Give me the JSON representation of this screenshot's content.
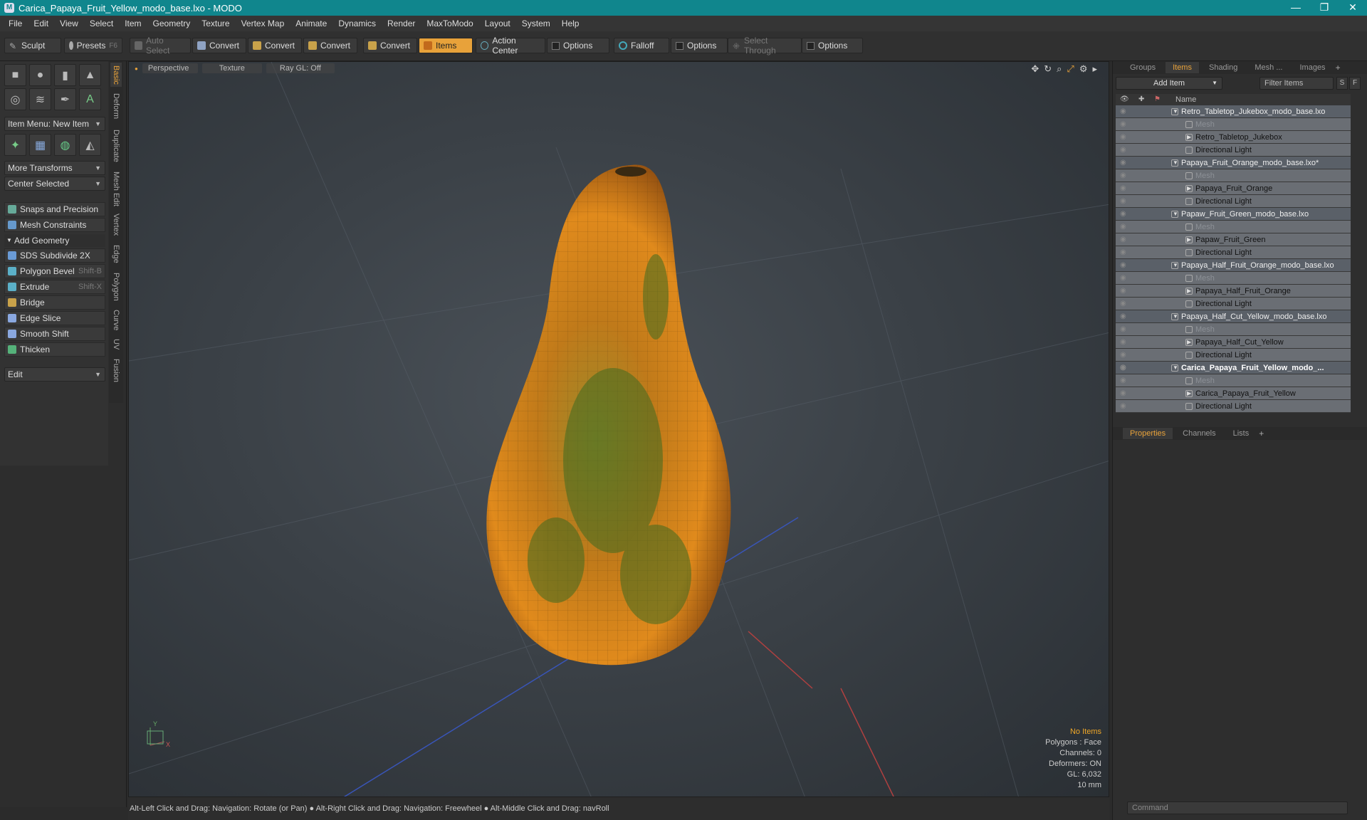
{
  "window": {
    "title": "Carica_Papaya_Fruit_Yellow_modo_base.lxo - MODO"
  },
  "menu": [
    "File",
    "Edit",
    "View",
    "Select",
    "Item",
    "Geometry",
    "Texture",
    "Vertex Map",
    "Animate",
    "Dynamics",
    "Render",
    "MaxToModo",
    "Layout",
    "System",
    "Help"
  ],
  "toolbar": {
    "sculpt": "Sculpt",
    "presets": "Presets",
    "presets_key": "F6",
    "auto_select": "Auto Select",
    "convert": "Convert",
    "items": "Items",
    "action_center": "Action Center",
    "options": "Options",
    "falloff": "Falloff",
    "select_through": "Select Through"
  },
  "left": {
    "item_menu": "Item Menu: New Item",
    "more_transforms": "More Transforms",
    "center_selected": "Center Selected",
    "snaps": "Snaps and Precision",
    "mesh_constraints": "Mesh Constraints",
    "add_geometry": "Add Geometry",
    "tools": [
      {
        "label": "SDS Subdivide 2X",
        "shortcut": "",
        "color": "#6a9bd6"
      },
      {
        "label": "Polygon Bevel",
        "shortcut": "Shift-B",
        "color": "#5bb0c8"
      },
      {
        "label": "Extrude",
        "shortcut": "Shift-X",
        "color": "#5bb0c8"
      },
      {
        "label": "Bridge",
        "shortcut": "",
        "color": "#c9a24a"
      },
      {
        "label": "Edge Slice",
        "shortcut": "",
        "color": "#8aa8e0"
      },
      {
        "label": "Smooth Shift",
        "shortcut": "",
        "color": "#8aa8e0"
      },
      {
        "label": "Thicken",
        "shortcut": "",
        "color": "#55b27a"
      }
    ],
    "edit_dropdown": "Edit",
    "vtabs": [
      "Basic",
      "Deform",
      "Duplicate",
      "Mesh Edit",
      "Vertex",
      "Edge",
      "Polygon",
      "Curve",
      "UV",
      "Fusion"
    ]
  },
  "viewport": {
    "perspective": "Perspective",
    "texture": "Texture",
    "raygl": "Ray GL: Off",
    "hud": {
      "no_items": "No Items",
      "polygons": "Polygons : Face",
      "channels": "Channels: 0",
      "deformers": "Deformers: ON",
      "gl": "GL: 6,032",
      "scale": "10 mm"
    },
    "axis_y": "Y",
    "axis_x": "X"
  },
  "status": "Alt-Left Click and Drag: Navigation: Rotate (or Pan) ● Alt-Right Click and Drag: Navigation: Freewheel ● Alt-Middle Click and Drag: navRoll",
  "right": {
    "tabs": [
      "Groups",
      "Items",
      "Shading",
      "Mesh ...",
      "Images"
    ],
    "add_item": "Add Item",
    "filter_items": "Filter Items",
    "s_btn": "S",
    "f_btn": "F",
    "name_col": "Name",
    "items": [
      {
        "label": "Retro_Tabletop_Jukebox_modo_base.lxo",
        "kind": "grp"
      },
      {
        "label": "Mesh",
        "kind": "mesh"
      },
      {
        "label": "Retro_Tabletop_Jukebox",
        "kind": "sub"
      },
      {
        "label": "Directional Light",
        "kind": "light"
      },
      {
        "label": "Papaya_Fruit_Orange_modo_base.lxo*",
        "kind": "grp"
      },
      {
        "label": "Mesh",
        "kind": "mesh"
      },
      {
        "label": "Papaya_Fruit_Orange",
        "kind": "sub"
      },
      {
        "label": "Directional Light",
        "kind": "light"
      },
      {
        "label": "Papaw_Fruit_Green_modo_base.lxo",
        "kind": "grp"
      },
      {
        "label": "Mesh",
        "kind": "mesh"
      },
      {
        "label": "Papaw_Fruit_Green",
        "kind": "sub"
      },
      {
        "label": "Directional Light",
        "kind": "light"
      },
      {
        "label": "Papaya_Half_Fruit_Orange_modo_base.lxo",
        "kind": "grp"
      },
      {
        "label": "Mesh",
        "kind": "mesh"
      },
      {
        "label": "Papaya_Half_Fruit_Orange",
        "kind": "sub"
      },
      {
        "label": "Directional Light",
        "kind": "light"
      },
      {
        "label": "Papaya_Half_Cut_Yellow_modo_base.lxo",
        "kind": "grp"
      },
      {
        "label": "Mesh",
        "kind": "mesh"
      },
      {
        "label": "Papaya_Half_Cut_Yellow",
        "kind": "sub"
      },
      {
        "label": "Directional Light",
        "kind": "light"
      },
      {
        "label": "Carica_Papaya_Fruit_Yellow_modo_...",
        "kind": "grp",
        "selected": true
      },
      {
        "label": "Mesh",
        "kind": "mesh"
      },
      {
        "label": "Carica_Papaya_Fruit_Yellow",
        "kind": "sub"
      },
      {
        "label": "Directional Light",
        "kind": "light"
      }
    ],
    "props_tabs": [
      "Properties",
      "Channels",
      "Lists"
    ],
    "command_placeholder": "Command"
  },
  "colors": {
    "accent": "#e8a23a",
    "titlebar": "#10868d"
  }
}
